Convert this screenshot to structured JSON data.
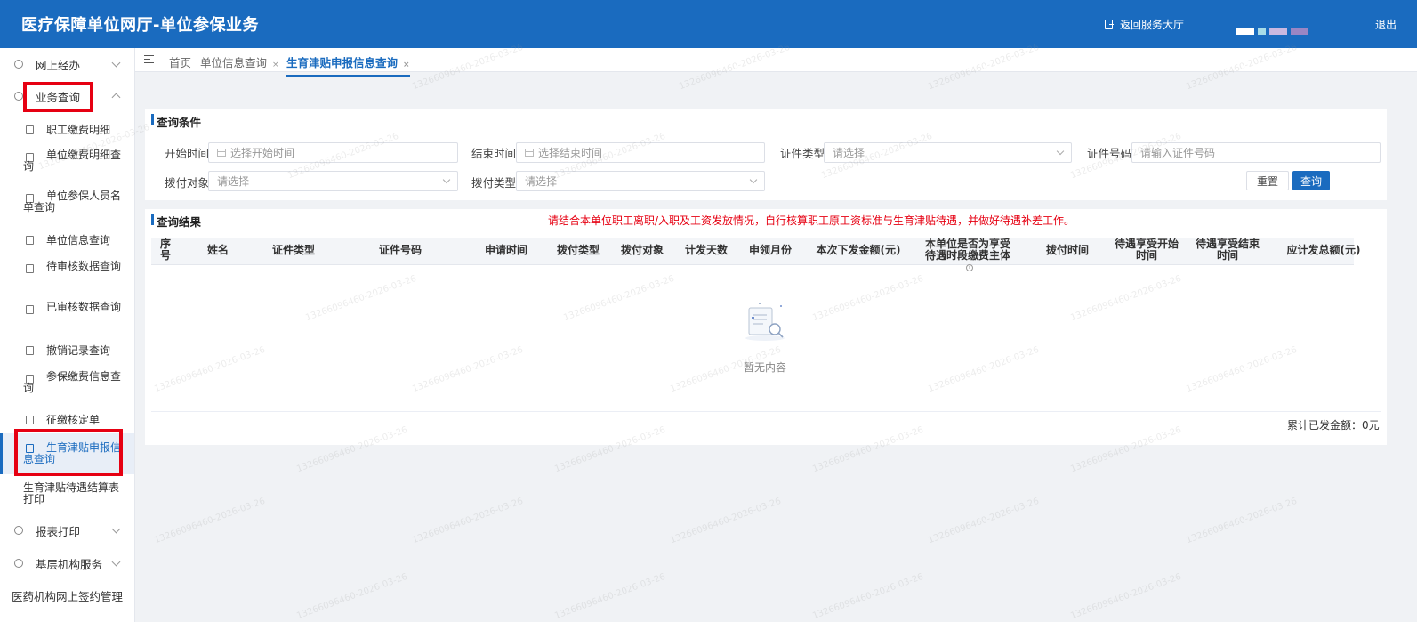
{
  "header": {
    "title": "医疗保障单位网厅-单位参保业务",
    "back_label": "返回服务大厅",
    "logout_label": "退出"
  },
  "sidebar": {
    "groups": [
      {
        "label": "网上经办",
        "expanded": false
      },
      {
        "label": "业务查询",
        "expanded": true
      },
      {
        "label": "报表打印",
        "expanded": false
      },
      {
        "label": "基层机构服务",
        "expanded": false
      },
      {
        "label": "医药机构网上签约管理",
        "expanded": false
      }
    ],
    "items": [
      {
        "label": "职工缴费明细"
      },
      {
        "label": "单位缴费明细查询"
      },
      {
        "label": "单位参保人员名单查询"
      },
      {
        "label": "单位信息查询"
      },
      {
        "label": "待审核数据查询"
      },
      {
        "label": "已审核数据查询"
      },
      {
        "label": "撤销记录查询"
      },
      {
        "label": "参保缴费信息查询"
      },
      {
        "label": "征缴核定单"
      },
      {
        "label": "生育津贴申报信息查询",
        "active": true
      },
      {
        "label": "生育津贴待遇结算表打印"
      }
    ]
  },
  "tabs": [
    {
      "label": "首页"
    },
    {
      "label": "单位信息查询",
      "closable": true
    },
    {
      "label": "生育津贴申报信息查询",
      "closable": true,
      "active": true
    }
  ],
  "query": {
    "section_title": "查询条件",
    "fields": {
      "start_time": {
        "label": "开始时间",
        "placeholder": "选择开始时间"
      },
      "end_time": {
        "label": "结束时间",
        "placeholder": "选择结束时间"
      },
      "cert_type": {
        "label": "证件类型",
        "placeholder": "请选择"
      },
      "cert_no": {
        "label": "证件号码",
        "placeholder": "请输入证件号码"
      },
      "pay_target": {
        "label": "拨付对象",
        "placeholder": "请选择"
      },
      "pay_type": {
        "label": "拨付类型",
        "placeholder": "请选择"
      }
    },
    "reset_label": "重置",
    "query_label": "查询"
  },
  "results": {
    "section_title": "查询结果",
    "notice": "请结合本单位职工离职/入职及工资发放情况，自行核算职工原工资标准与生育津贴待遇，并做好待遇补差工作。",
    "columns": [
      "序号",
      "姓名",
      "证件类型",
      "证件号码",
      "申请时间",
      "拨付类型",
      "拨付对象",
      "计发天数",
      "申领月份",
      "本次下发金额(元)",
      "本单位是否为享受待遇时段缴费主体",
      "拨付时间",
      "待遇享受开始时间",
      "待遇享受结束时间",
      "应计发总额(元)"
    ],
    "empty_text": "暂无内容",
    "total_label": "累计已发金额：0元"
  },
  "watermark": "13266096460-2026-03-26",
  "colors": {
    "primary": "#1a6bbf",
    "highlight": "#e60012",
    "notice": "#e60012"
  }
}
